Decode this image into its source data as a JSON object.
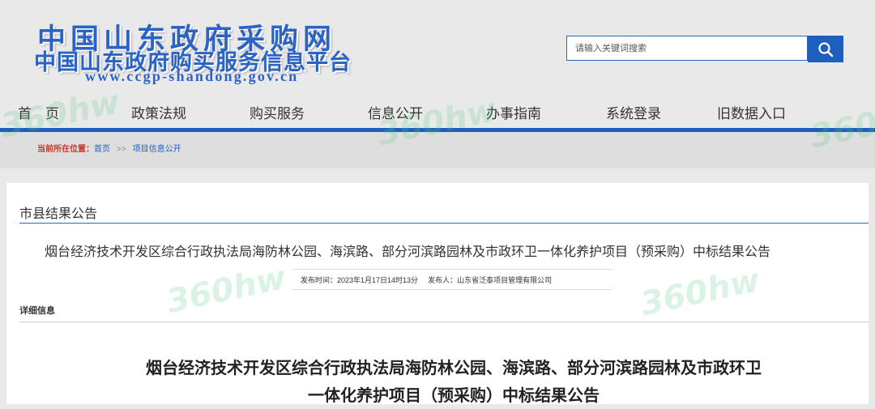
{
  "header": {
    "logo_line1": "中国山东政府采购网",
    "logo_line2": "中国山东政府购买服务信息平台",
    "logo_url": "www.ccgp-shandong.gov.cn",
    "search_placeholder": "请输入关键词搜索",
    "search_icon": "search-icon"
  },
  "nav": {
    "items": [
      "首　页",
      "政策法规",
      "购买服务",
      "信息公开",
      "办事指南",
      "系统登录",
      "旧数据入口"
    ]
  },
  "breadcrumb": {
    "label": "当前所在位置：",
    "home": "首页",
    "sep": ">>",
    "current": "项目信息公开"
  },
  "section": {
    "title": "市县结果公告"
  },
  "announcement": {
    "title": "烟台经济技术开发区综合行政执法局海防林公园、海滨路、部分河滨路园林及市政环卫一体化养护项目（预采购）中标结果公告",
    "publish_time": "发布时间：2023年1月17日14时13分",
    "publisher": "发布人：山东省泛泰项目管理有限公司",
    "detail_label": "详细信息",
    "doc_title_line1": "烟台经济技术开发区综合行政执法局海防林公园、海滨路、部分河滨路园林及市政环卫",
    "doc_title_line2": "一体化养护项目（预采购）中标结果公告"
  },
  "colors": {
    "brand_blue": "#2a63c4",
    "nav_line": "#1e5fbd",
    "breadcrumb_label": "#c0392b"
  }
}
